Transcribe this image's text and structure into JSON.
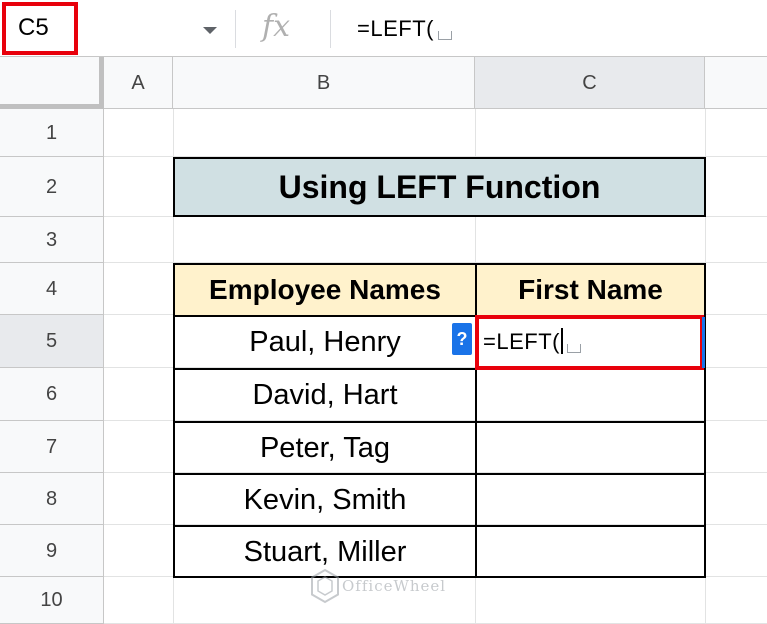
{
  "formula_bar": {
    "name_box": "C5",
    "fx_label": "fx",
    "formula": "=LEFT("
  },
  "columns": [
    {
      "label": "A",
      "active": false
    },
    {
      "label": "B",
      "active": false
    },
    {
      "label": "C",
      "active": true
    }
  ],
  "rows": [
    {
      "label": "1",
      "active": false
    },
    {
      "label": "2",
      "active": false
    },
    {
      "label": "3",
      "active": false
    },
    {
      "label": "4",
      "active": false
    },
    {
      "label": "5",
      "active": true
    },
    {
      "label": "6",
      "active": false
    },
    {
      "label": "7",
      "active": false
    },
    {
      "label": "8",
      "active": false
    },
    {
      "label": "9",
      "active": false
    },
    {
      "label": "10",
      "active": false
    }
  ],
  "sheet": {
    "title": "Using LEFT Function",
    "headers": [
      "Employee Names",
      "First Name"
    ],
    "employees": [
      "Paul, Henry",
      "David, Hart",
      "Peter, Tag",
      "Kevin, Smith",
      "Stuart, Miller"
    ],
    "first_names": [
      "",
      "",
      "",
      "",
      ""
    ],
    "active_cell_value": "=LEFT(",
    "help_icon": "?"
  },
  "watermark": {
    "text": "OfficeWheel"
  },
  "colors": {
    "highlight_red": "#e8000b",
    "title_fill": "#d0e0e3",
    "header_fill": "#fff2cc",
    "selection_blue": "#1a73e8"
  }
}
